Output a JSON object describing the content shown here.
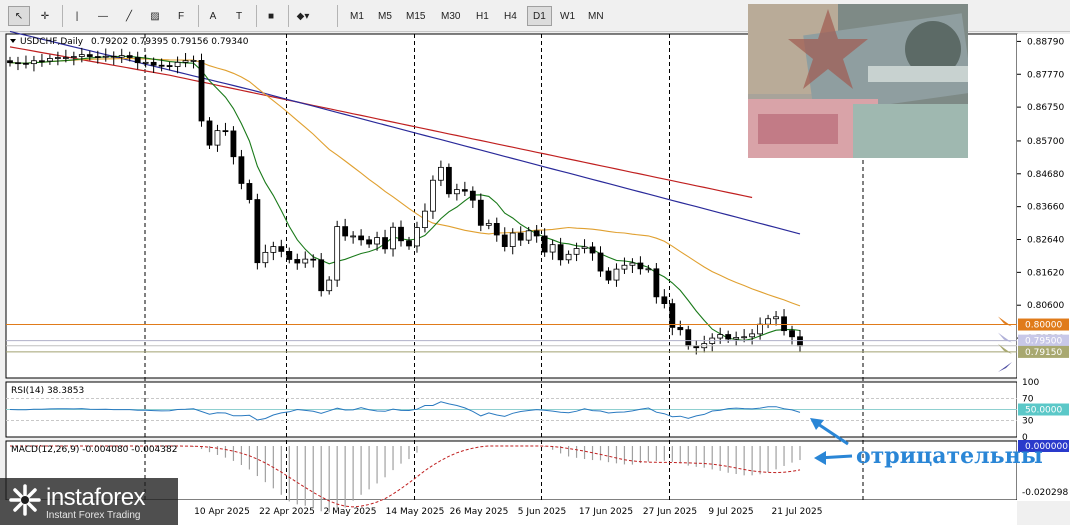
{
  "toolbar": {
    "tools": [
      {
        "name": "cursor-icon",
        "glyph": "↖"
      },
      {
        "name": "crosshair-icon",
        "glyph": "✛"
      },
      {
        "name": "vertical-line-icon",
        "glyph": "|"
      },
      {
        "name": "horizontal-line-icon",
        "glyph": "—"
      },
      {
        "name": "trendline-icon",
        "glyph": "╱"
      },
      {
        "name": "channel-icon",
        "glyph": "▨"
      },
      {
        "name": "fibonacci-icon",
        "glyph": "F"
      },
      {
        "name": "text-icon",
        "glyph": "A"
      },
      {
        "name": "text-label-icon",
        "glyph": "T"
      },
      {
        "name": "rectangle-icon",
        "glyph": "■"
      },
      {
        "name": "shapes-icon",
        "glyph": "◆▾"
      }
    ],
    "timeframes": [
      "M1",
      "M5",
      "M15",
      "M30",
      "H1",
      "H4",
      "D1",
      "W1",
      "MN"
    ],
    "active_timeframe": "D1"
  },
  "chart": {
    "symbol_label": "USDCHF,Daily",
    "ohlc_label": "0.79202 0.79395 0.79156 0.79340",
    "price_axis": [
      "0.88790",
      "0.87770",
      "0.86750",
      "0.85700",
      "0.84680",
      "0.83660",
      "0.82640",
      "0.81620",
      "0.80600",
      "0.79580"
    ],
    "tag_prices": [
      {
        "value": "0.80000",
        "color": "#e07b1a"
      },
      {
        "value": "0.79500",
        "color": "#c8c8e8"
      },
      {
        "value": "0.79150",
        "color": "#a8a870"
      }
    ],
    "date_axis": [
      "10 Apr 2025",
      "22 Apr 2025",
      "2 May 2025",
      "14 May 2025",
      "26 May 2025",
      "5 Jun 2025",
      "17 Jun 2025",
      "27 Jun 2025",
      "9 Jul 2025",
      "21 Jul 2025"
    ],
    "rsi": {
      "label": "RSI(14) 38.3853",
      "levels": [
        "100",
        "70",
        "30",
        "0"
      ],
      "tag": "50.0000"
    },
    "macd": {
      "label": "MACD(12,26,9) -0.004080 -0.004382",
      "tag": "0.000000",
      "bottom": "-0.020298"
    }
  },
  "annotation": {
    "text": "отрицательны"
  },
  "logo": {
    "brand": "instaforex",
    "tagline": "Instant Forex Trading"
  },
  "colors": {
    "bg": "#ffffff",
    "bull": "#ffffff",
    "bear": "#000000",
    "ma_fast": "#1a7a1a",
    "ma_mid": "#e0a030",
    "ma_slow": "#2a2a9a",
    "ma_long": "#c02020",
    "level": "#e07b1a",
    "rsi": "#2a7ac0",
    "macd_signal": "#c02020",
    "arrow": "#2a86d6"
  },
  "chart_data": {
    "type": "candlestick",
    "title": "USDCHF,Daily",
    "ylim": [
      0.7834,
      0.8902
    ],
    "yticks": [
      0.8879,
      0.8777,
      0.8675,
      0.857,
      0.8468,
      0.8366,
      0.8264,
      0.8162,
      0.806,
      0.7958
    ],
    "date_ticks": [
      "10 Apr 2025",
      "22 Apr 2025",
      "2 May 2025",
      "14 May 2025",
      "26 May 2025",
      "5 Jun 2025",
      "17 Jun 2025",
      "27 Jun 2025",
      "9 Jul 2025",
      "21 Jul 2025"
    ],
    "last": {
      "open": 0.79202,
      "high": 0.79395,
      "low": 0.79156,
      "close": 0.7934
    },
    "horizontal_levels": [
      0.8,
      0.795,
      0.7915
    ],
    "close": [
      0.8813,
      0.8811,
      0.881,
      0.8819,
      0.8818,
      0.8826,
      0.8829,
      0.8829,
      0.8832,
      0.8838,
      0.8832,
      0.8831,
      0.8833,
      0.883,
      0.8835,
      0.8829,
      0.8813,
      0.8814,
      0.8805,
      0.8804,
      0.8801,
      0.8814,
      0.8819,
      0.882,
      0.8632,
      0.8557,
      0.8602,
      0.8601,
      0.8521,
      0.8438,
      0.8388,
      0.8192,
      0.8224,
      0.8242,
      0.8227,
      0.8202,
      0.8191,
      0.8203,
      0.8201,
      0.8105,
      0.8138,
      0.8304,
      0.8275,
      0.8275,
      0.8263,
      0.825,
      0.827,
      0.8235,
      0.8302,
      0.826,
      0.8244,
      0.8301,
      0.8352,
      0.8448,
      0.8488,
      0.8406,
      0.8419,
      0.8414,
      0.8386,
      0.8308,
      0.8314,
      0.8278,
      0.8242,
      0.8284,
      0.8262,
      0.8291,
      0.8275,
      0.8225,
      0.8248,
      0.8201,
      0.8218,
      0.8236,
      0.8241,
      0.8222,
      0.8166,
      0.8138,
      0.8172,
      0.8184,
      0.8191,
      0.8173,
      0.8173,
      0.8086,
      0.8065,
      0.7991,
      0.7984,
      0.7934,
      0.7928,
      0.7941,
      0.7958,
      0.7969,
      0.7955,
      0.796,
      0.7962,
      0.7971,
      0.8001,
      0.8018,
      0.8024,
      0.7981,
      0.7962,
      0.7934
    ]
  }
}
